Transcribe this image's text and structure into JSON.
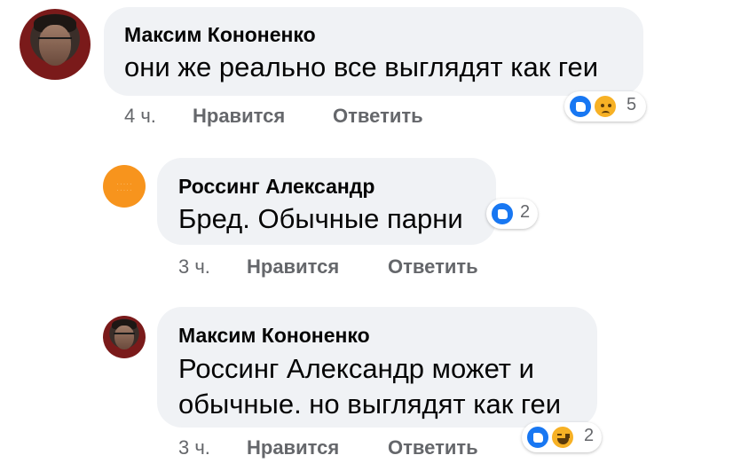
{
  "comments": [
    {
      "author": "Максим Кононенко",
      "lines": [
        "они же реально все выглядят как геи"
      ],
      "time": "4 ч.",
      "like_label": "Нравится",
      "reply_label": "Ответить",
      "reactions": [
        "like-icon",
        "sad-icon"
      ],
      "reaction_count": "5"
    },
    {
      "author": "Россинг Александр",
      "lines": [
        "Бред. Обычные парни"
      ],
      "time": "3 ч.",
      "like_label": "Нравится",
      "reply_label": "Ответить",
      "reactions": [
        "like-icon"
      ],
      "reaction_count": "2"
    },
    {
      "author": "Максим Кононенко",
      "lines": [
        "Россинг Александр может и",
        "обычные. но выглядят как геи"
      ],
      "time": "3 ч.",
      "like_label": "Нравится",
      "reply_label": "Ответить",
      "reactions": [
        "like-icon",
        "haha-icon"
      ],
      "reaction_count": "2"
    }
  ],
  "colors": {
    "bubble": "#f0f2f5",
    "meta_text": "#65676b",
    "like_blue": "#1877f2",
    "emoji_yellow": "#f7b125"
  }
}
